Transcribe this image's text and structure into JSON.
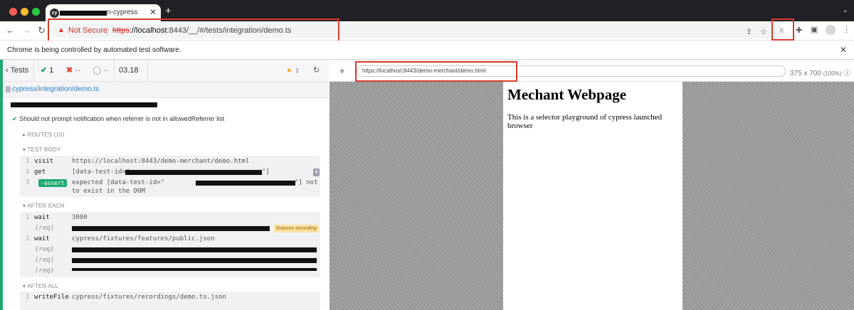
{
  "browser": {
    "tab_title": "n-cypress",
    "tab_favicon": "cy",
    "url_scheme": "https",
    "url_host": "://localhost",
    "url_rest": ":8443/__/#/tests/integration/demo.ts",
    "not_secure": "Not Secure",
    "extension_label": "K.",
    "infobar_text": "Chrome is being controlled by automated test software."
  },
  "runner": {
    "back_label": "Tests",
    "passed": "1",
    "failed": "--",
    "pending": "--",
    "duration": "03.18",
    "spec_file": "cypress/integration/demo.ts",
    "test_title": "Should not prompt notification when referrer is not in allowedReferrer list",
    "routes_label": "ROUTES (10)",
    "test_body_label": "TEST BODY",
    "after_each_label": "AFTER EACH",
    "after_all_label": "AFTER ALL",
    "body_cmds": [
      {
        "n": "1",
        "c": "visit",
        "m": "https://localhost:8443/demo-merchant/demo.html"
      },
      {
        "n": "2",
        "c": "get",
        "m": "[data-test-id=\"",
        "m_end": "\"]",
        "badge": "0"
      },
      {
        "n": "3",
        "c": "-assert",
        "m": "expected [data-test-id=\"",
        "m_end": "\"] not",
        "m2": "to exist in the DOM"
      }
    ],
    "after_each_cmds": [
      {
        "n": "1",
        "c": "wait",
        "m": "3000"
      },
      {
        "req": "(req)",
        "tag": "features-recording"
      },
      {
        "n": "2",
        "c": "wait",
        "m": "cypress/fixtures/features/public.json"
      },
      {
        "req": "(req)"
      },
      {
        "req": "(req)"
      },
      {
        "req": "(req)"
      }
    ],
    "after_all_cmds": [
      {
        "n": "1",
        "c": "writeFile",
        "m": "cypress/fixtures/recordings/demo.ts.json"
      }
    ]
  },
  "aut": {
    "url": "https://localhost:8443/demo-merchant/demo.html",
    "viewport": "375 x 700",
    "scale": "(100%)",
    "heading": "Mechant Webpage",
    "body": "This is a selector playground of cypress launched browser"
  },
  "colors": {
    "pass": "#1fa971",
    "fail": "#e2473f",
    "highlight": "#d93b2b"
  }
}
